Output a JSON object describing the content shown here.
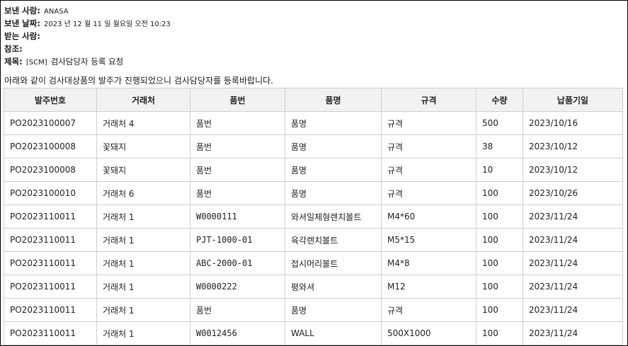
{
  "header": {
    "sender_label": "보낸 사람:",
    "sender_value": "ANASA",
    "date_label": "보낸 날짜:",
    "date_value": "2023 년 12 월 11 일 월요일 오전 10:23",
    "to_label": "받는 사람:",
    "to_value": "",
    "cc_label": "참조:",
    "cc_value": "",
    "subject_label": "제목:",
    "subject_tag": "[SCM]",
    "subject_value": "검사담당자 등록 요청"
  },
  "body": {
    "intro": "아래와 같이 검사대상품의 발주가 진행되었으니 검사담당자를 등록바랍니다."
  },
  "table": {
    "columns": [
      "발주번호",
      "거래처",
      "품번",
      "품명",
      "규격",
      "수량",
      "납품기일"
    ],
    "rows": [
      [
        "PO2023100007",
        "거래처 4",
        "품번",
        "품명",
        "규격",
        "500",
        "2023/10/16"
      ],
      [
        "PO2023100008",
        "꽃돼지",
        "품번",
        "품명",
        "규격",
        "38",
        "2023/10/12"
      ],
      [
        "PO2023100008",
        "꽃돼지",
        "품번",
        "품명",
        "규격",
        "10",
        "2023/10/12"
      ],
      [
        "PO2023100010",
        "거래처 6",
        "품번",
        "품명",
        "규격",
        "100",
        "2023/10/26"
      ],
      [
        "PO2023110011",
        "거래처 1",
        "W0000111",
        "와셔일체형렌치볼트",
        "M4*60",
        "100",
        "2023/11/24"
      ],
      [
        "PO2023110011",
        "거래처 1",
        "PJT-1000-01",
        "육각렌치볼트",
        "M5*15",
        "100",
        "2023/11/24"
      ],
      [
        "PO2023110011",
        "거래처 1",
        "ABC-2000-01",
        "접시머리볼트",
        "M4*8",
        "100",
        "2023/11/24"
      ],
      [
        "PO2023110011",
        "거래처 1",
        "W0000222",
        "평와셔",
        "M12",
        "100",
        "2023/11/24"
      ],
      [
        "PO2023110011",
        "거래처 1",
        "품번",
        "품명",
        "규격",
        "100",
        "2023/11/24"
      ],
      [
        "PO2023110011",
        "거래처 1",
        "W0012456",
        "WALL",
        "500X1000",
        "100",
        "2023/11/24"
      ]
    ]
  }
}
